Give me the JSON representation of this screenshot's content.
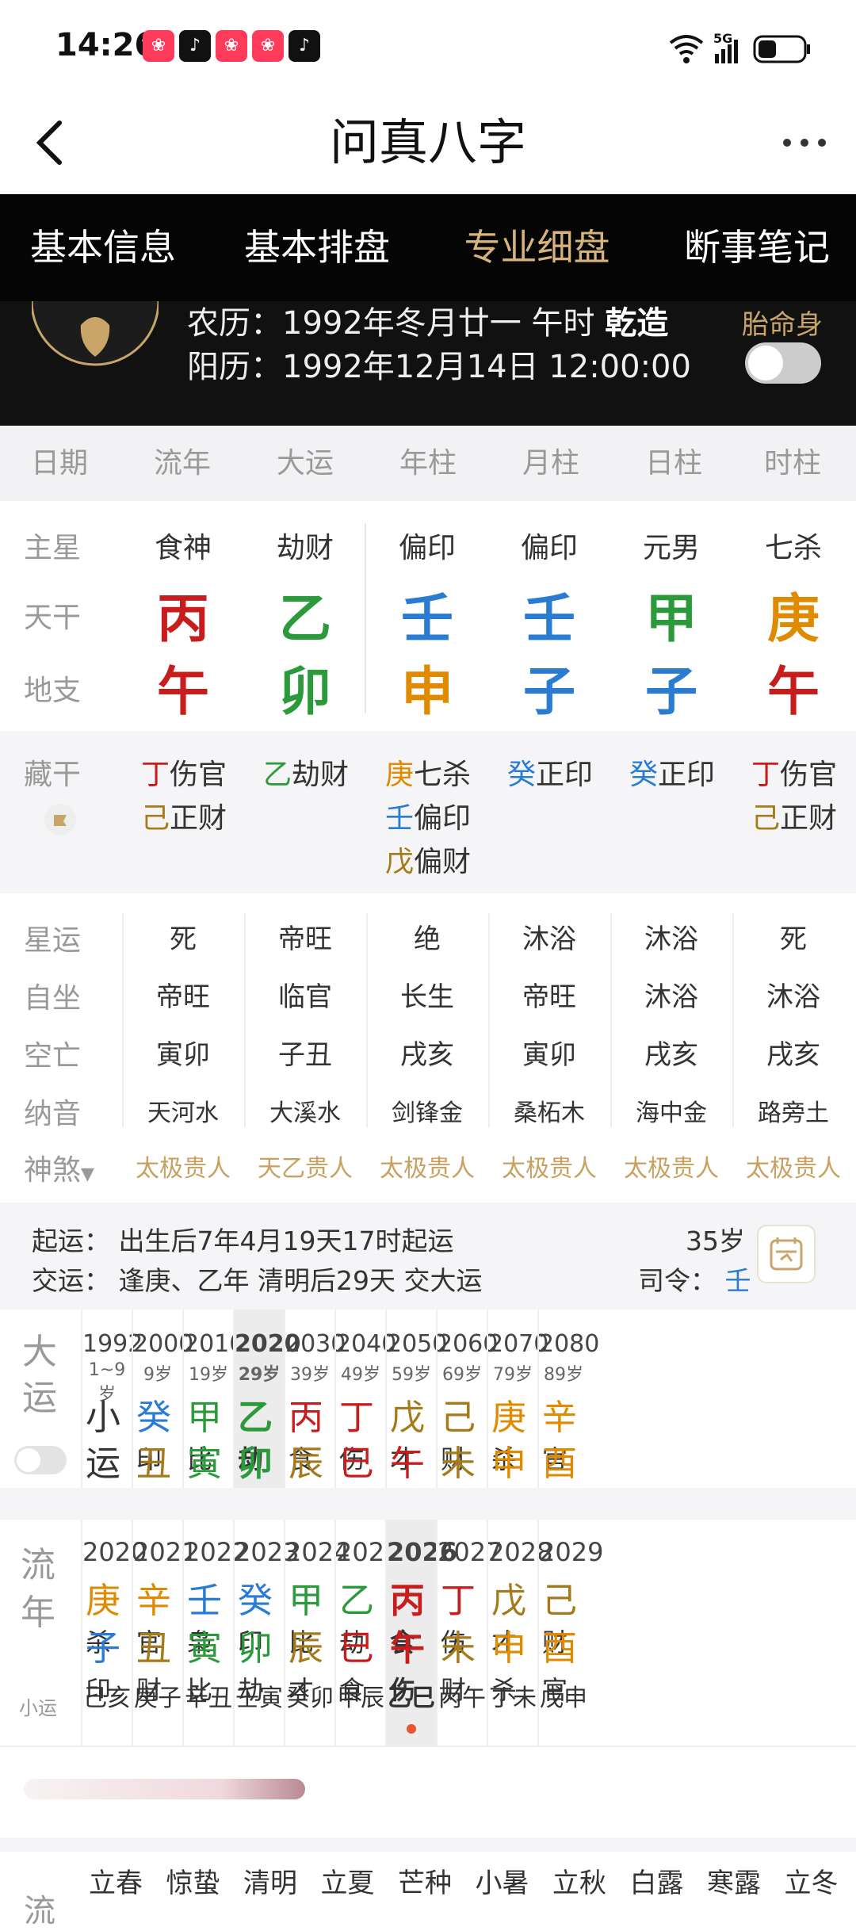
{
  "status": {
    "time": "14:26",
    "network": "5G"
  },
  "header": {
    "title": "问真八字"
  },
  "tabs": [
    {
      "label": "基本信息",
      "active": false
    },
    {
      "label": "基本排盘",
      "active": false
    },
    {
      "label": "专业细盘",
      "active": true
    },
    {
      "label": "断事笔记",
      "active": false
    }
  ],
  "profile": {
    "lunar_prefix": "农历：1992年冬月廿一 午时",
    "lunar_gender": "乾造",
    "solar": "阳历：1992年12月14日 12:00:00",
    "taimingshen_label": "胎命身"
  },
  "columns": [
    "日期",
    "流年",
    "大运",
    "年柱",
    "月柱",
    "日柱",
    "时柱"
  ],
  "rows": {
    "zhuxing": {
      "label": "主星",
      "values": [
        "食神",
        "劫财",
        "偏印",
        "偏印",
        "元男",
        "七杀"
      ]
    },
    "tiangan": {
      "label": "天干",
      "values": [
        "丙",
        "乙",
        "壬",
        "壬",
        "甲",
        "庚"
      ]
    },
    "dizhi": {
      "label": "地支",
      "values": [
        "午",
        "卯",
        "申",
        "子",
        "子",
        "午"
      ]
    }
  },
  "canggan": {
    "label": "藏干",
    "cols": [
      [
        {
          "g": "丁",
          "t": "伤官"
        },
        {
          "g": "己",
          "t": "正财"
        }
      ],
      [
        {
          "g": "乙",
          "t": "劫财"
        }
      ],
      [
        {
          "g": "庚",
          "t": "七杀"
        },
        {
          "g": "壬",
          "t": "偏印"
        },
        {
          "g": "戊",
          "t": "偏财"
        }
      ],
      [
        {
          "g": "癸",
          "t": "正印"
        }
      ],
      [
        {
          "g": "癸",
          "t": "正印"
        }
      ],
      [
        {
          "g": "丁",
          "t": "伤官"
        },
        {
          "g": "己",
          "t": "正财"
        }
      ]
    ]
  },
  "luck_rows": {
    "xingyun": {
      "label": "星运",
      "values": [
        "死",
        "帝旺",
        "绝",
        "沐浴",
        "沐浴",
        "死"
      ]
    },
    "zizuo": {
      "label": "自坐",
      "values": [
        "帝旺",
        "临官",
        "长生",
        "帝旺",
        "沐浴",
        "沐浴"
      ]
    },
    "kongwang": {
      "label": "空亡",
      "values": [
        "寅卯",
        "子丑",
        "戌亥",
        "寅卯",
        "戌亥",
        "戌亥"
      ]
    },
    "nayin": {
      "label": "纳音",
      "values": [
        "天河水",
        "大溪水",
        "剑锋金",
        "桑柘木",
        "海中金",
        "路旁土"
      ]
    },
    "shensha": {
      "label": "神煞",
      "values": [
        "太极贵人",
        "天乙贵人",
        "太极贵人",
        "太极贵人",
        "太极贵人",
        "太极贵人"
      ]
    }
  },
  "start": {
    "qiyun": "起运：  出生后7年4月19天17时起运",
    "jiaoyun": "交运：  逢庚、乙年 清明后29天 交大运",
    "age": "35岁",
    "siling_label": "司令：",
    "siling_value": "壬"
  },
  "dayun": {
    "label": "大运",
    "items": [
      {
        "year": "1992",
        "age": "1~9岁",
        "top": "小",
        "topSuffix": "",
        "bot": "运",
        "botSuffix": ""
      },
      {
        "year": "2000",
        "age": "9岁",
        "top": "癸",
        "topSuffix": "印",
        "bot": "丑",
        "botSuffix": "财"
      },
      {
        "year": "2010",
        "age": "19岁",
        "top": "甲",
        "topSuffix": "比",
        "bot": "寅",
        "botSuffix": "比"
      },
      {
        "year": "2020",
        "age": "29岁",
        "top": "乙",
        "topSuffix": "劫",
        "bot": "卯",
        "botSuffix": "劫"
      },
      {
        "year": "2030",
        "age": "39岁",
        "top": "丙",
        "topSuffix": "食",
        "bot": "辰",
        "botSuffix": "才"
      },
      {
        "year": "2040",
        "age": "49岁",
        "top": "丁",
        "topSuffix": "伤",
        "bot": "巳",
        "botSuffix": "食"
      },
      {
        "year": "2050",
        "age": "59岁",
        "top": "戊",
        "topSuffix": "才",
        "bot": "午",
        "botSuffix": "伤"
      },
      {
        "year": "2060",
        "age": "69岁",
        "top": "己",
        "topSuffix": "财",
        "bot": "未",
        "botSuffix": "财"
      },
      {
        "year": "2070",
        "age": "79岁",
        "top": "庚",
        "topSuffix": "杀",
        "bot": "申",
        "botSuffix": "杀"
      },
      {
        "year": "2080",
        "age": "89岁",
        "top": "辛",
        "topSuffix": "官",
        "bot": "酉",
        "botSuffix": "官"
      }
    ]
  },
  "liunian": {
    "label": "流年",
    "sublabel": "小运",
    "items": [
      {
        "year": "2020",
        "top": "庚",
        "topSuffix": "杀",
        "bot": "子",
        "botSuffix": "印",
        "xy": "己亥"
      },
      {
        "year": "2021",
        "top": "辛",
        "topSuffix": "官",
        "bot": "丑",
        "botSuffix": "财",
        "xy": "庚子"
      },
      {
        "year": "2022",
        "top": "壬",
        "topSuffix": "枭",
        "bot": "寅",
        "botSuffix": "比",
        "xy": "辛丑"
      },
      {
        "year": "2023",
        "top": "癸",
        "topSuffix": "印",
        "bot": "卯",
        "botSuffix": "劫",
        "xy": "壬寅"
      },
      {
        "year": "2024",
        "top": "甲",
        "topSuffix": "比",
        "bot": "辰",
        "botSuffix": "才",
        "xy": "癸卯"
      },
      {
        "year": "2025",
        "top": "乙",
        "topSuffix": "劫",
        "bot": "巳",
        "botSuffix": "食",
        "xy": "甲辰"
      },
      {
        "year": "2026",
        "top": "丙",
        "topSuffix": "食",
        "bot": "午",
        "botSuffix": "伤",
        "xy": "乙巳"
      },
      {
        "year": "2027",
        "top": "丁",
        "topSuffix": "伤",
        "bot": "未",
        "botSuffix": "财",
        "xy": "丙午"
      },
      {
        "year": "2028",
        "top": "戊",
        "topSuffix": "才",
        "bot": "申",
        "botSuffix": "杀",
        "xy": "丁未"
      },
      {
        "year": "2029",
        "top": "己",
        "topSuffix": "财",
        "bot": "酉",
        "botSuffix": "官",
        "xy": "戊申"
      }
    ]
  },
  "solar_terms": [
    "立春",
    "惊蛰",
    "清明",
    "立夏",
    "芒种",
    "小暑",
    "立秋",
    "白露",
    "寒露",
    "立冬"
  ],
  "colors": {
    "red": "#c81d1d",
    "green": "#2b9a3a",
    "blue": "#2a7bd2",
    "orange": "#e08a00",
    "brown": "#a57a1a",
    "gold": "#c8a161"
  }
}
